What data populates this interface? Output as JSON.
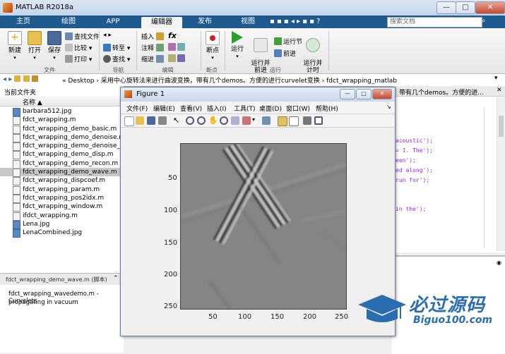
{
  "app": {
    "title": "MATLAB R2018a"
  },
  "tabs": [
    {
      "label": "主页"
    },
    {
      "label": "绘图"
    },
    {
      "label": "APP"
    },
    {
      "label": "编辑器"
    },
    {
      "label": "发布"
    },
    {
      "label": "视图"
    }
  ],
  "search": {
    "placeholder": "搜索文档"
  },
  "ribbon": {
    "file": {
      "new": "新建",
      "open": "打开",
      "save": "保存",
      "find_files": "查找文件",
      "compare": "比较",
      "print": "打印",
      "group": "文件"
    },
    "nav": {
      "goto": "转至",
      "find": "查找",
      "group": "导航"
    },
    "edit": {
      "insert": "插入",
      "comment": "注释",
      "indent": "缩进",
      "fx": "fx",
      "group": "编辑"
    },
    "breakpoints": {
      "breakpoint": "断点",
      "group": "断点"
    },
    "run": {
      "run": "运行",
      "run_advance": "运行并\n前进",
      "run_section": "运行节",
      "advance": "前进",
      "run_time": "运行并\n计时",
      "group": "运行"
    }
  },
  "address": {
    "path": "« Desktop › 采用中心旋转法来进行曲波变换，带有几个demos。方便的进行curvelet变换 › fdct_wrapping_matlab"
  },
  "files_panel": {
    "title": "当前文件夹",
    "column": "名称 ▲",
    "files": [
      {
        "name": "barbara512.jpg",
        "type": "img"
      },
      {
        "name": "fdct_wrapping.m",
        "type": "m"
      },
      {
        "name": "fdct_wrapping_demo_basic.m",
        "type": "m"
      },
      {
        "name": "fdct_wrapping_demo_denoise.m",
        "type": "m"
      },
      {
        "name": "fdct_wrapping_demo_denoise_enh",
        "type": "m"
      },
      {
        "name": "fdct_wrapping_demo_disp.m",
        "type": "m"
      },
      {
        "name": "fdct_wrapping_demo_recon.m",
        "type": "m"
      },
      {
        "name": "fdct_wrapping_demo_wave.m",
        "type": "m",
        "selected": true
      },
      {
        "name": "fdct_wrapping_dispcoef.m",
        "type": "m"
      },
      {
        "name": "fdct_wrapping_param.m",
        "type": "m"
      },
      {
        "name": "fdct_wrapping_pos2idx.m",
        "type": "m"
      },
      {
        "name": "fdct_wrapping_window.m",
        "type": "m"
      },
      {
        "name": "ifdct_wrapping.m",
        "type": "m"
      },
      {
        "name": "Lena.jpg",
        "type": "img"
      },
      {
        "name": "LenaCombined.jpg",
        "type": "img"
      }
    ]
  },
  "detail": {
    "header": "fdct_wrapping_demo_wave.m  (脚本)",
    "line1": "fdct_wrapping_wavedemo.m - Curvelets",
    "line2": "propagating in vacuum"
  },
  "editor": {
    "tab_text": "带有几个demos。方便的进...",
    "code_lines": [
      " acoustic');",
      "= 1. The');",
      "een');",
      "ed along');",
      " run for');",
      "in the');"
    ]
  },
  "figure": {
    "title": "Figure 1",
    "menus": [
      "文件(F)",
      "编辑(E)",
      "查看(V)",
      "插入(I)",
      "工具(T)",
      "桌面(D)",
      "窗口(W)",
      "帮助(H)"
    ],
    "yticks": [
      "50",
      "100",
      "150",
      "200",
      "250"
    ],
    "xticks": [
      "50",
      "100",
      "150",
      "200",
      "250"
    ]
  },
  "watermark": {
    "text": "必过源码",
    "url": "Biguo100.com"
  },
  "colors": {
    "tabbar": "#1f5a8f",
    "accent": "#2a6db0"
  }
}
